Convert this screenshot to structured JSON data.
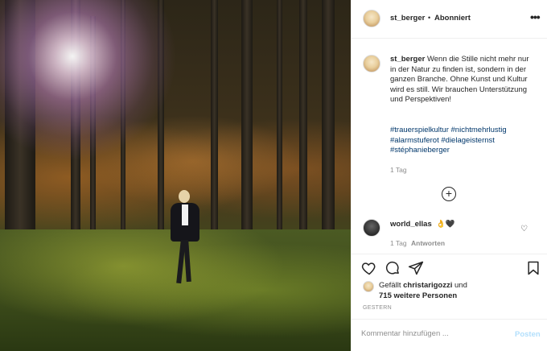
{
  "post": {
    "username": "st_berger",
    "separator": "•",
    "follow_status": "Abonniert",
    "more_label": "•••"
  },
  "caption": {
    "username": "st_berger",
    "text": "Wenn die Stille nicht mehr nur in der Natur zu finden ist, sondern in der ganzen Branche. Ohne Kunst und Kultur wird es still. Wir brauchen Unterstützung und Perspektiven!",
    "hashtags": [
      "#trauerspielkultur",
      "#nichtmehrlustig",
      "#alarmstuferot",
      "#dielageisternst",
      "#stéphanieberger"
    ],
    "time": "1 Tag"
  },
  "add_comment_symbol": "+",
  "comment": {
    "username": "world_ellas",
    "text": "👌🖤",
    "time": "1 Tag",
    "reply_label": "Antworten",
    "heart_symbol": "♡"
  },
  "likes": {
    "prefix": "Gefällt ",
    "liker": "christarigozzi",
    "middle": " und",
    "others": "715 weitere Personen"
  },
  "date_label": "GESTERN",
  "comment_input": {
    "placeholder": "Kommentar hinzufügen ...",
    "post_label": "Posten"
  },
  "icons": [
    "heart-icon",
    "comment-icon",
    "share-icon",
    "bookmark-icon",
    "plus-circle-icon",
    "more-icon"
  ],
  "colors": {
    "link": "#00376b",
    "muted": "#8e8e8e",
    "post_disabled": "#b2dffc",
    "text": "#262626"
  }
}
